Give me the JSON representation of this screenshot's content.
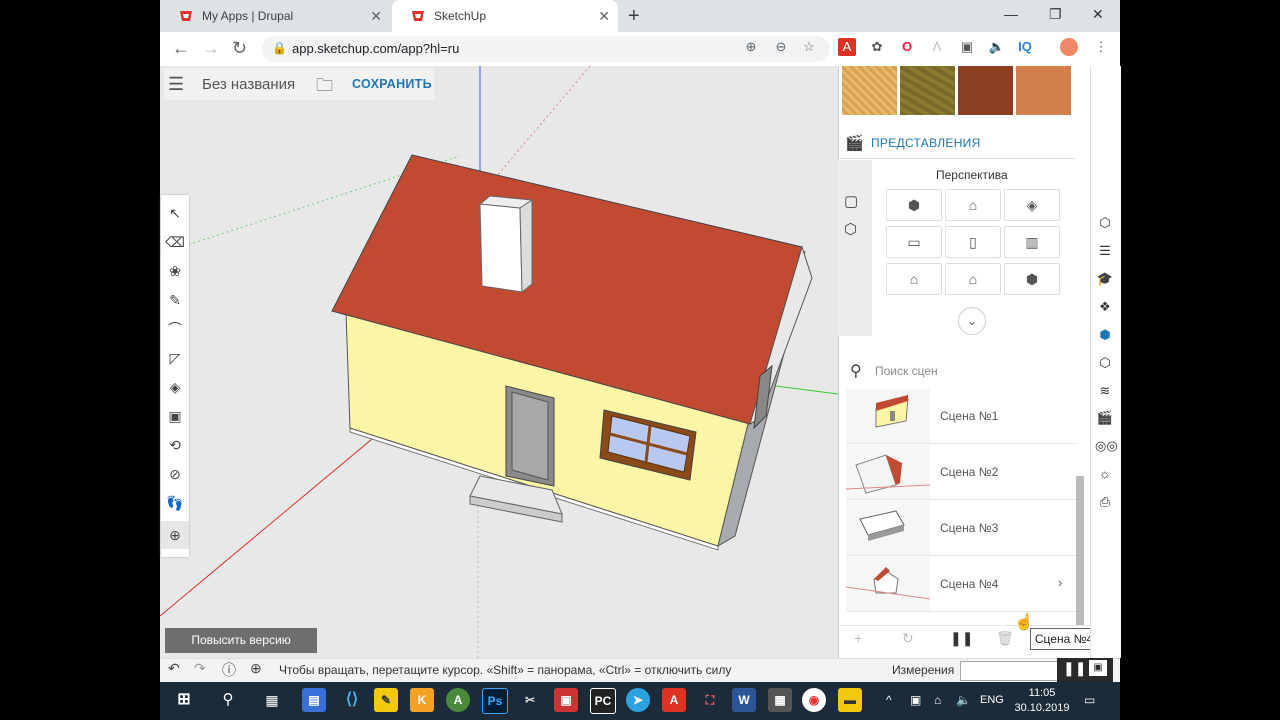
{
  "browser": {
    "tabs": [
      {
        "title": "My Apps | Drupal",
        "active": false
      },
      {
        "title": "SketchUp",
        "active": true
      }
    ],
    "new_tab_icon": "plus-icon",
    "url": "app.sketchup.com/app?hl=ru",
    "window_controls": [
      "minimize-icon",
      "restore-icon",
      "close-icon"
    ]
  },
  "app": {
    "doc_name": "Без названия",
    "save_label": "СОХРАНИТЬ",
    "upgrade_label": "Повысить версию",
    "tools": [
      "select-icon",
      "eraser-icon",
      "paint-bucket-icon",
      "pencil-icon",
      "arc-icon",
      "rectangle-icon",
      "push-pull-icon",
      "offset-icon",
      "orbit-icon",
      "tape-measure-icon",
      "walk-icon",
      "section-plane-icon"
    ],
    "materials_colors": [
      "#e8b86a",
      "#7a6a2a",
      "#8a4020",
      "#d4804a"
    ],
    "views_panel": {
      "title": "ПРЕДСТАВЛЕНИЯ",
      "mode_label": "Перспектива",
      "view_icons": [
        "iso-icon",
        "top-icon",
        "front-icon",
        "bottom-icon",
        "right-icon",
        "back-icon",
        "left-icon",
        "house-front-icon",
        "house-iso-icon"
      ]
    },
    "scenes": {
      "search_placeholder": "Поиск сцен",
      "items": [
        {
          "label": "Сцена №1"
        },
        {
          "label": "Сцена №2"
        },
        {
          "label": "Сцена №3"
        },
        {
          "label": "Сцена №4"
        }
      ],
      "tooltip": "Сцена №4"
    },
    "status": {
      "hint": "Чтобы вращать, перетащите курсор. «Shift» = панорама, «Ctrl» = отключить силу",
      "measurements_label": "Измерения"
    }
  },
  "taskbar": {
    "lang": "ENG",
    "time": "11:05",
    "date": "30.10.2019"
  }
}
